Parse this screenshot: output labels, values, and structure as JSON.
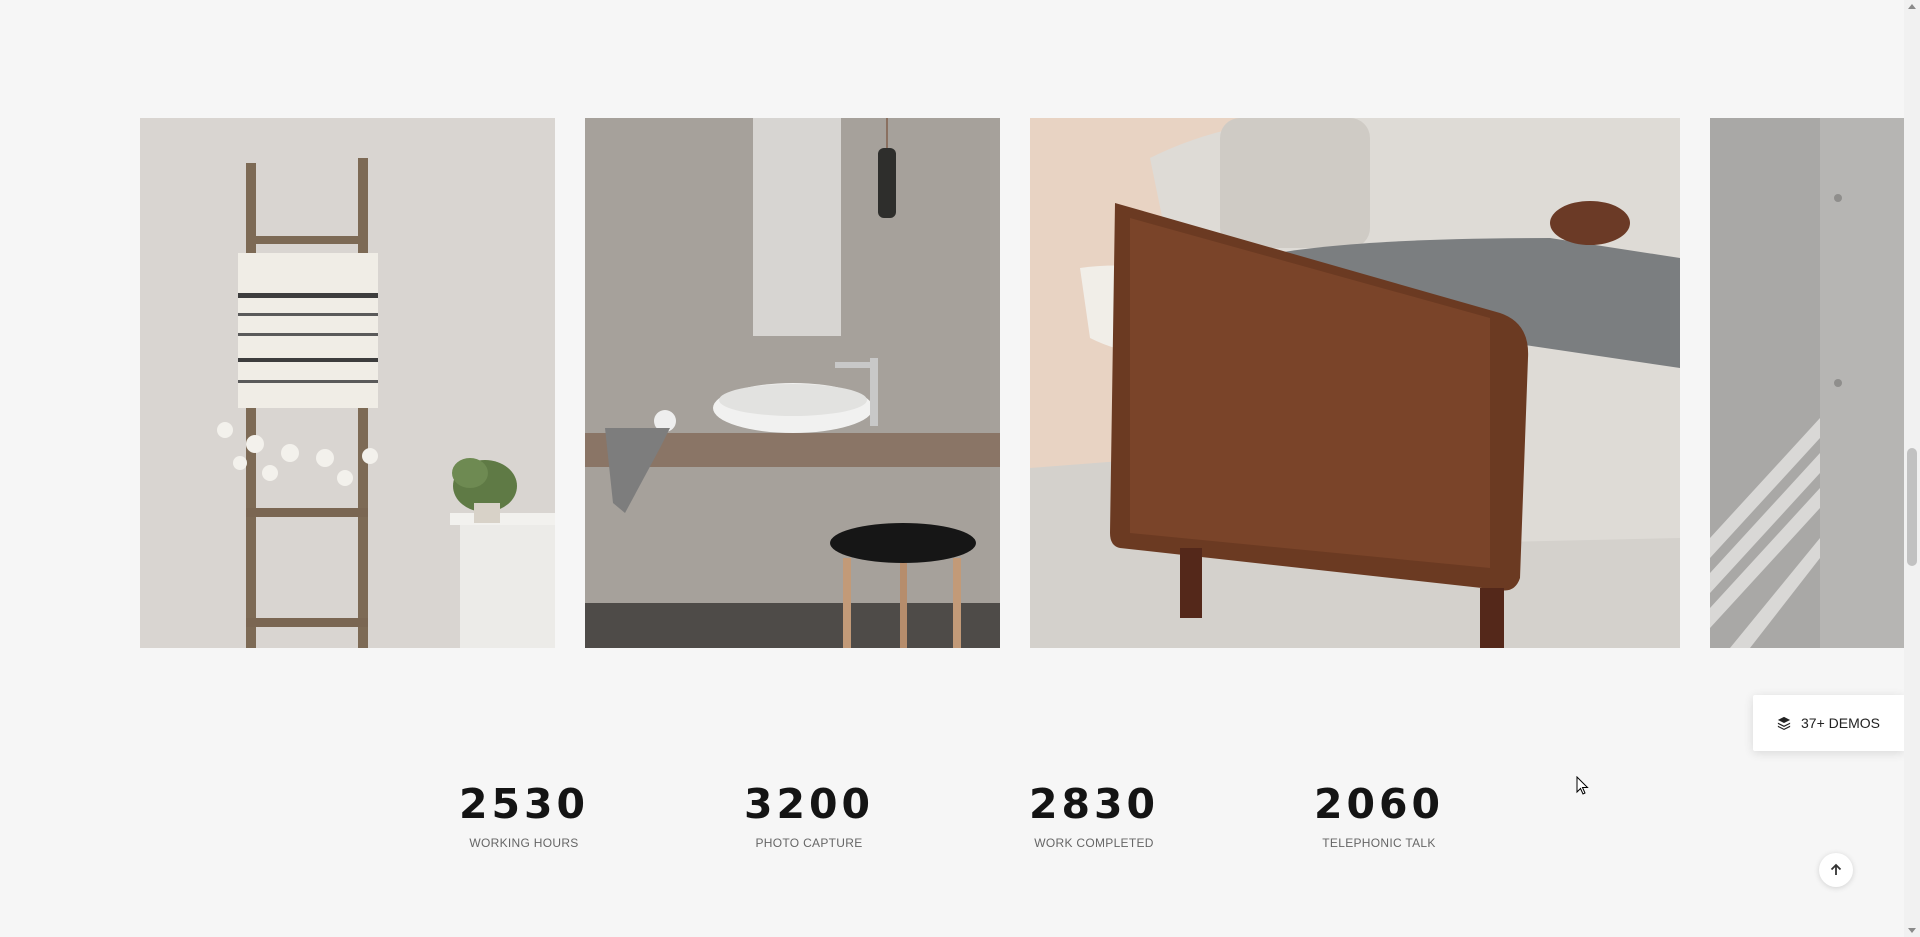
{
  "gallery": {
    "items": [
      {
        "icon": "ladder-blanket-photo"
      },
      {
        "icon": "bathroom-sink-photo"
      },
      {
        "icon": "armchair-lounging-photo"
      },
      {
        "icon": "concrete-wall-shadow-photo"
      }
    ]
  },
  "counters": [
    {
      "value": "2530",
      "label": "WORKING HOURS"
    },
    {
      "value": "3200",
      "label": "PHOTO CAPTURE"
    },
    {
      "value": "2830",
      "label": "WORK COMPLETED"
    },
    {
      "value": "2060",
      "label": "TELEPHONIC TALK"
    }
  ],
  "demos_button": {
    "label": "37+ DEMOS",
    "icon": "layers-icon"
  },
  "back_to_top": {
    "icon": "arrow-up-icon"
  },
  "colors": {
    "background": "#f6f6f6",
    "text": "#141414",
    "muted": "#666666"
  }
}
